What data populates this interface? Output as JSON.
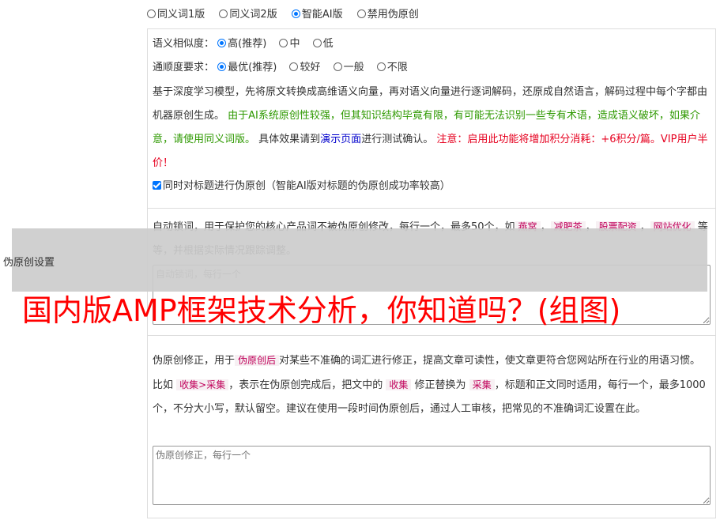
{
  "version_options": [
    {
      "label": "同义词1版",
      "selected": false
    },
    {
      "label": "同义词2版",
      "selected": false
    },
    {
      "label": "智能AI版",
      "selected": true
    },
    {
      "label": "禁用伪原创",
      "selected": false
    }
  ],
  "similarity": {
    "label": "语义相似度：",
    "options": [
      {
        "label": "高(推荐)",
        "selected": true
      },
      {
        "label": "中",
        "selected": false
      },
      {
        "label": "低",
        "selected": false
      }
    ]
  },
  "fluency": {
    "label": "通顺度要求：",
    "options": [
      {
        "label": "最优(推荐)",
        "selected": true
      },
      {
        "label": "较好",
        "selected": false
      },
      {
        "label": "一般",
        "selected": false
      },
      {
        "label": "不限",
        "selected": false
      }
    ]
  },
  "ai_description": {
    "intro": "基于深度学习模型，先将原文转换成高维语义向量，再对语义向量进行逐词解码，还原成自然语言，解码过程中每个字都由机器原创生成。",
    "warning_green": "由于AI系统原创性较强，但其知识结构毕竟有限，有可能无法识别一些专有术语，造成语义破坏，如果介意，请使用同义词版。",
    "test_prefix": "具体效果请到",
    "test_link": "演示页面",
    "test_suffix": "进行测试确认。",
    "cost_red": "注意：启用此功能将增加积分消耗：+6积分/篇。VIP用户半价！"
  },
  "title_checkbox": {
    "label": "同时对标题进行伪原创（智能AI版对标题的伪原创成功率较高）",
    "checked": true
  },
  "lock_words": {
    "text1": "自动锁词，用于保护您的核心产品词不被伪原创修改，每行一个，最多50个，如",
    "examples": [
      "燕窝",
      "减肥茶",
      "股票配资",
      "网站优化"
    ],
    "sep": "，",
    "text2": "等等，并根据实际情况跟踪调整。",
    "placeholder": "自动锁词，每行一个"
  },
  "corrections": {
    "t1": "伪原创修正，用于",
    "tag1": "伪原创后",
    "t2": "对某些不准确的词汇进行修正，提高文章可读性，使文章更符合您网站所在行业的用语习惯。比如",
    "tag2": "收集>采集",
    "t3": "，表示在伪原创完成后，把文中的",
    "tag3": "收集",
    "t4": "修正替换为",
    "tag4": "采集",
    "t5": "，标题和正文同时适用，每行一个，最多1000个，不分大小写，默认留空。建议在使用一段时间伪原创后，通过人工审核，把常见的不准确词汇设置在此。",
    "placeholder": "伪原创修正，每行一个"
  },
  "side_label": "伪原创设置",
  "headline": "国内版AMP框架技术分析，你知道吗？(组图)"
}
